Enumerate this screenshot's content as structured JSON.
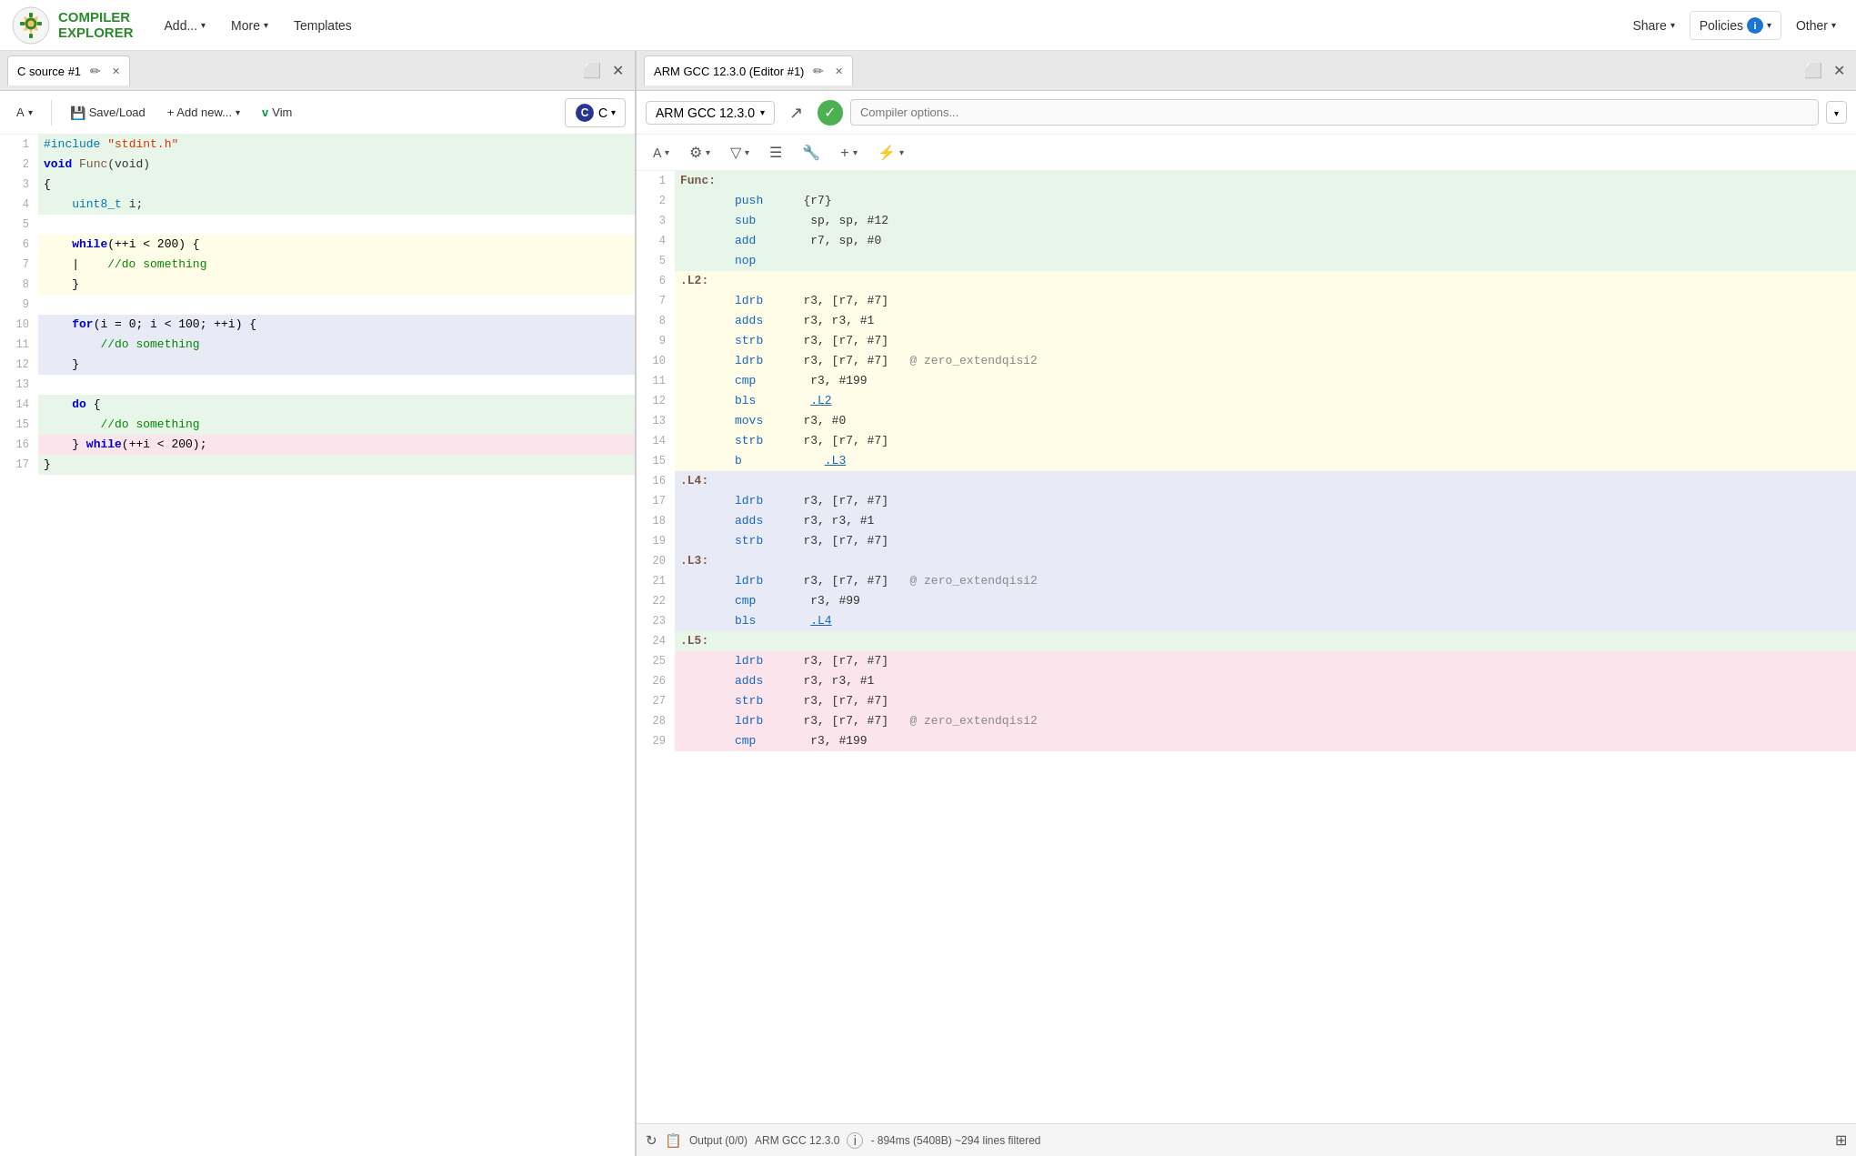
{
  "nav": {
    "logo_line1": "COMPILER",
    "logo_line2": "EXPLORER",
    "add_label": "Add...",
    "more_label": "More",
    "templates_label": "Templates",
    "share_label": "Share",
    "policies_label": "Policies",
    "policies_icon": "i",
    "other_label": "Other"
  },
  "left_pane": {
    "tab_title": "C source #1",
    "font_btn": "A",
    "save_load_label": "Save/Load",
    "add_new_label": "+ Add new...",
    "vim_label": "Vim",
    "lang_label": "C",
    "lines": [
      {
        "num": 1,
        "content": "#include \"stdint.h\"",
        "bg": "green"
      },
      {
        "num": 2,
        "content": "void Func(void)",
        "bg": "green"
      },
      {
        "num": 3,
        "content": "{",
        "bg": "green"
      },
      {
        "num": 4,
        "content": "    uint8_t i;",
        "bg": "green"
      },
      {
        "num": 5,
        "content": "",
        "bg": "white"
      },
      {
        "num": 6,
        "content": "    while(++i < 200) {",
        "bg": "yellow"
      },
      {
        "num": 7,
        "content": "    |    //do something",
        "bg": "yellow"
      },
      {
        "num": 8,
        "content": "    }",
        "bg": "yellow"
      },
      {
        "num": 9,
        "content": "",
        "bg": "white"
      },
      {
        "num": 10,
        "content": "    for(i = 0; i < 100; ++i) {",
        "bg": "blue"
      },
      {
        "num": 11,
        "content": "        //do something",
        "bg": "blue"
      },
      {
        "num": 12,
        "content": "    }",
        "bg": "blue"
      },
      {
        "num": 13,
        "content": "",
        "bg": "white"
      },
      {
        "num": 14,
        "content": "    do {",
        "bg": "green"
      },
      {
        "num": 15,
        "content": "        //do something",
        "bg": "green"
      },
      {
        "num": 16,
        "content": "    } while(++i < 200);",
        "bg": "pink"
      },
      {
        "num": 17,
        "content": "}",
        "bg": "green"
      }
    ]
  },
  "right_pane": {
    "tab_title": "ARM GCC 12.3.0 (Editor #1)",
    "compiler_name": "ARM GCC 12.3.0",
    "compiler_options_placeholder": "Compiler options...",
    "asm_lines": [
      {
        "num": 1,
        "label": "Func:",
        "instr": "",
        "operands": "",
        "comment": "",
        "bg": "green"
      },
      {
        "num": 2,
        "label": "",
        "instr": "push",
        "operands": "   {r7}",
        "comment": "",
        "bg": "green"
      },
      {
        "num": 3,
        "label": "",
        "instr": "sub",
        "operands": "    sp, sp, #12",
        "comment": "",
        "bg": "green"
      },
      {
        "num": 4,
        "label": "",
        "instr": "add",
        "operands": "    r7, sp, #0",
        "comment": "",
        "bg": "green"
      },
      {
        "num": 5,
        "label": "",
        "instr": "nop",
        "operands": "",
        "comment": "",
        "bg": "green"
      },
      {
        "num": 6,
        "label": ".L2:",
        "instr": "",
        "operands": "",
        "comment": "",
        "bg": "yellow"
      },
      {
        "num": 7,
        "label": "",
        "instr": "ldrb",
        "operands": "   r3, [r7, #7]",
        "comment": "",
        "bg": "yellow"
      },
      {
        "num": 8,
        "label": "",
        "instr": "adds",
        "operands": "   r3, r3, #1",
        "comment": "",
        "bg": "yellow"
      },
      {
        "num": 9,
        "label": "",
        "instr": "strb",
        "operands": "   r3, [r7, #7]",
        "comment": "",
        "bg": "yellow"
      },
      {
        "num": 10,
        "label": "",
        "instr": "ldrb",
        "operands": "   r3, [r7, #7]",
        "comment": "   @ zero_extendqisi2",
        "bg": "yellow"
      },
      {
        "num": 11,
        "label": "",
        "instr": "cmp",
        "operands": "    r3, #199",
        "comment": "",
        "bg": "yellow"
      },
      {
        "num": 12,
        "label": "",
        "instr": "bls",
        "operands": "    .L2",
        "comment": "",
        "bg": "yellow",
        "link": ".L2"
      },
      {
        "num": 13,
        "label": "",
        "instr": "movs",
        "operands": "   r3, #0",
        "comment": "",
        "bg": "yellow"
      },
      {
        "num": 14,
        "label": "",
        "instr": "strb",
        "operands": "   r3, [r7, #7]",
        "comment": "",
        "bg": "yellow"
      },
      {
        "num": 15,
        "label": "",
        "instr": "b",
        "operands": "      .L3",
        "comment": "",
        "bg": "yellow",
        "link": ".L3"
      },
      {
        "num": 16,
        "label": ".L4:",
        "instr": "",
        "operands": "",
        "comment": "",
        "bg": "blue"
      },
      {
        "num": 17,
        "label": "",
        "instr": "ldrb",
        "operands": "   r3, [r7, #7]",
        "comment": "",
        "bg": "blue"
      },
      {
        "num": 18,
        "label": "",
        "instr": "adds",
        "operands": "   r3, r3, #1",
        "comment": "",
        "bg": "blue"
      },
      {
        "num": 19,
        "label": "",
        "instr": "strb",
        "operands": "   r3, [r7, #7]",
        "comment": "",
        "bg": "blue"
      },
      {
        "num": 20,
        "label": ".L3:",
        "instr": "",
        "operands": "",
        "comment": "",
        "bg": "blue"
      },
      {
        "num": 21,
        "label": "",
        "instr": "ldrb",
        "operands": "   r3, [r7, #7]",
        "comment": "   @ zero_extendqisi2",
        "bg": "blue"
      },
      {
        "num": 22,
        "label": "",
        "instr": "cmp",
        "operands": "    r3, #99",
        "comment": "",
        "bg": "blue"
      },
      {
        "num": 23,
        "label": "",
        "instr": "bls",
        "operands": "    .L4",
        "comment": "",
        "bg": "blue",
        "link": ".L4"
      },
      {
        "num": 24,
        "label": ".L5:",
        "instr": "",
        "operands": "",
        "comment": "",
        "bg": "green"
      },
      {
        "num": 25,
        "label": "",
        "instr": "ldrb",
        "operands": "   r3, [r7, #7]",
        "comment": "",
        "bg": "pink"
      },
      {
        "num": 26,
        "label": "",
        "instr": "adds",
        "operands": "   r3, r3, #1",
        "comment": "",
        "bg": "pink"
      },
      {
        "num": 27,
        "label": "",
        "instr": "strb",
        "operands": "   r3, [r7, #7]",
        "comment": "",
        "bg": "pink"
      },
      {
        "num": 28,
        "label": "",
        "instr": "ldrb",
        "operands": "   r3, [r7, #7]",
        "comment": "   @ zero_extendqisi2",
        "bg": "pink"
      },
      {
        "num": 29,
        "label": "",
        "instr": "cmp",
        "operands": "    r3, #199",
        "comment": "",
        "bg": "pink"
      }
    ],
    "status_output": "Output (0/0)",
    "status_compiler": "ARM GCC 12.3.0",
    "status_timing": "- 894ms (5408B) ~294 lines filtered"
  },
  "colors": {
    "bg_green": "#e8f5e9",
    "bg_yellow": "#fffde7",
    "bg_blue": "#e8eaf6",
    "bg_pink": "#fce4ec",
    "bg_white": "#ffffff",
    "accent_blue": "#1565c0",
    "accent_green": "#4caf50",
    "accent_brown": "#795548"
  }
}
